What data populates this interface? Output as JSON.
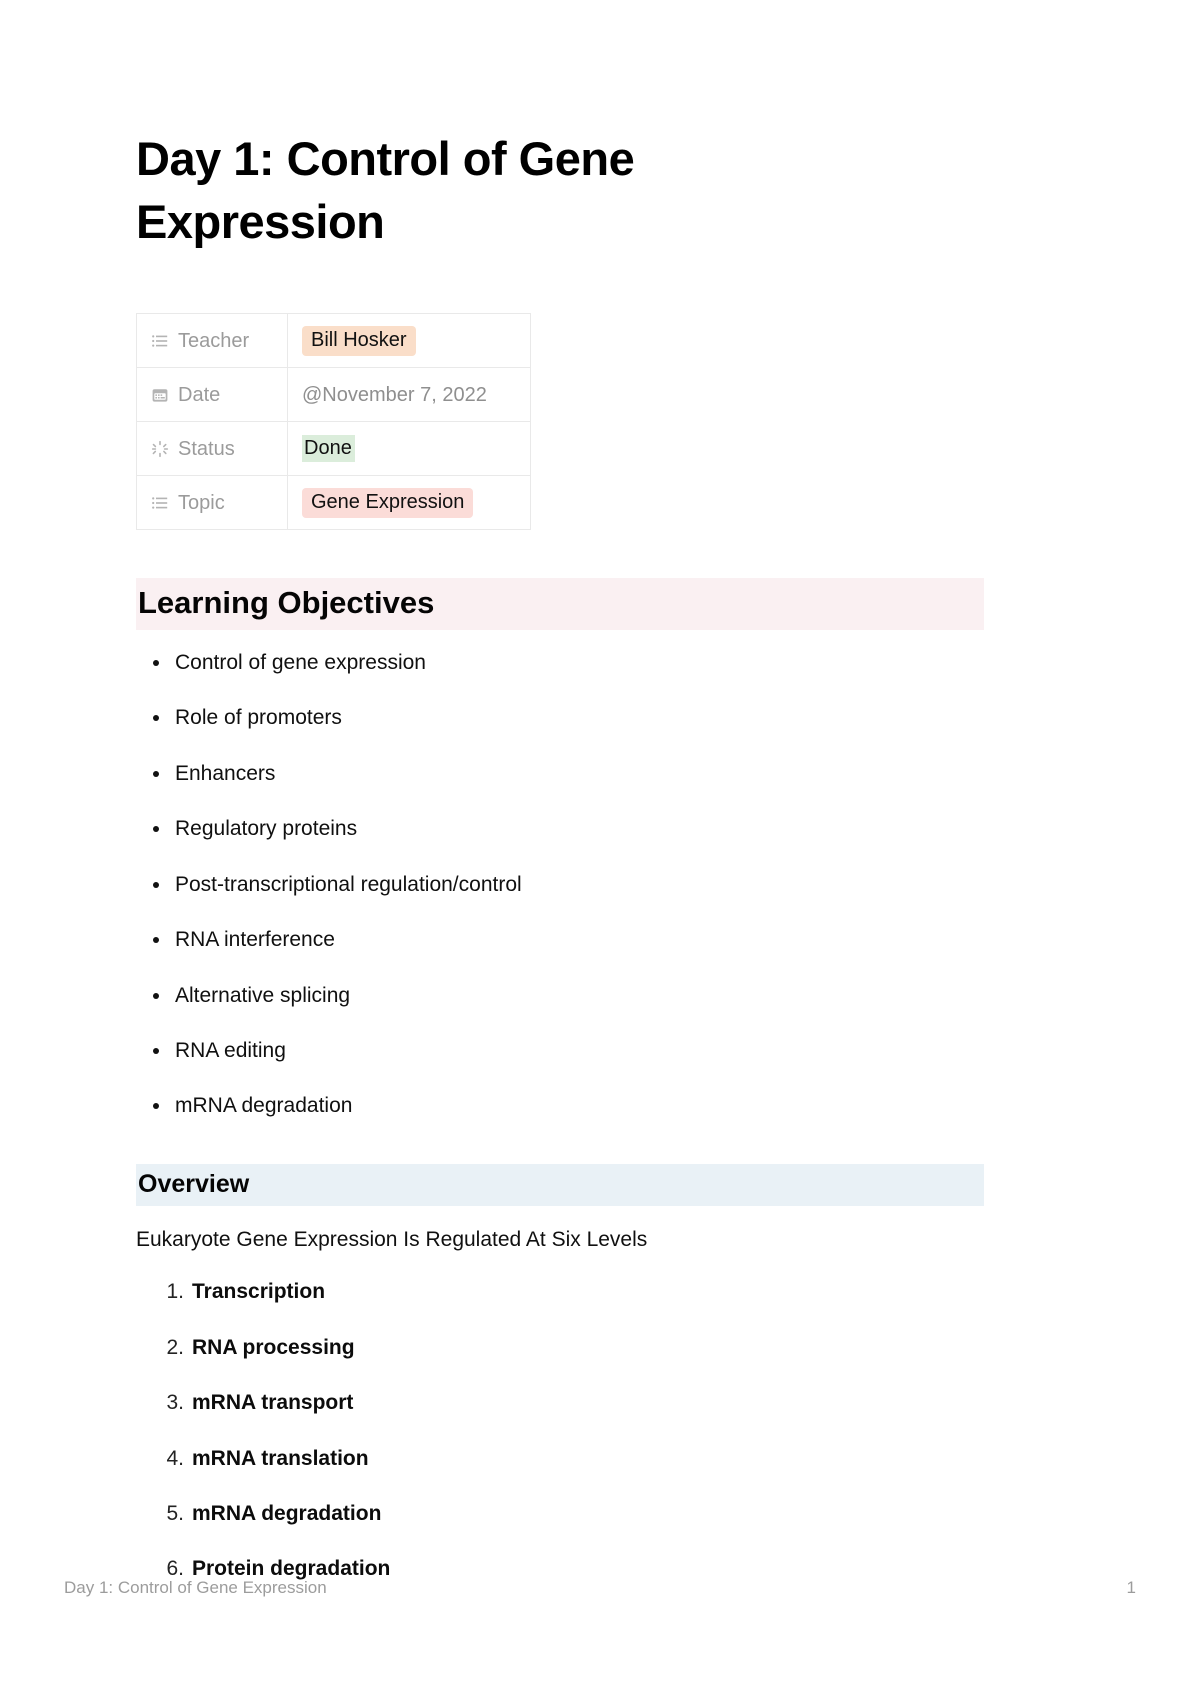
{
  "document": {
    "title": "Day 1: Control of Gene Expression"
  },
  "properties": {
    "rows": [
      {
        "icon": "list-icon",
        "key": "Teacher",
        "value": "Bill Hosker",
        "style": "tag-teacher"
      },
      {
        "icon": "calendar-icon",
        "key": "Date",
        "value": "@November 7, 2022",
        "style": "date-text"
      },
      {
        "icon": "spinner-icon",
        "key": "Status",
        "value": "Done",
        "style": "highlight-green"
      },
      {
        "icon": "list-icon",
        "key": "Topic",
        "value": "Gene Expression",
        "style": "tag-topic"
      }
    ]
  },
  "learning_objectives": {
    "heading": "Learning Objectives",
    "items": [
      "Control of gene expression",
      "Role of promoters",
      "Enhancers",
      "Regulatory proteins",
      "Post-transcriptional regulation/control",
      "RNA interference",
      "Alternative splicing",
      "RNA editing",
      "mRNA degradation"
    ]
  },
  "overview": {
    "heading": "Overview",
    "lead": "Eukaryote Gene Expression Is Regulated At Six Levels",
    "items": [
      {
        "number": "1.",
        "label": "Transcription"
      },
      {
        "number": "2.",
        "label": "RNA processing"
      },
      {
        "number": "3.",
        "label": "mRNA transport"
      },
      {
        "number": "4.",
        "label": "mRNA translation"
      },
      {
        "number": "5.",
        "label": "mRNA degradation"
      },
      {
        "number": "6.",
        "label": "Protein degradation"
      }
    ]
  },
  "footer": {
    "left": "Day 1: Control of Gene Expression",
    "page": "1"
  },
  "colors": {
    "tag_teacher_bg": "#fadec9",
    "tag_topic_bg": "#fbdcd8",
    "status_highlight_bg": "#dbeddb",
    "heading_objectives_bg": "#faf0f2",
    "heading_overview_bg": "#e9f1f6",
    "muted_text": "#9b9b9b"
  }
}
